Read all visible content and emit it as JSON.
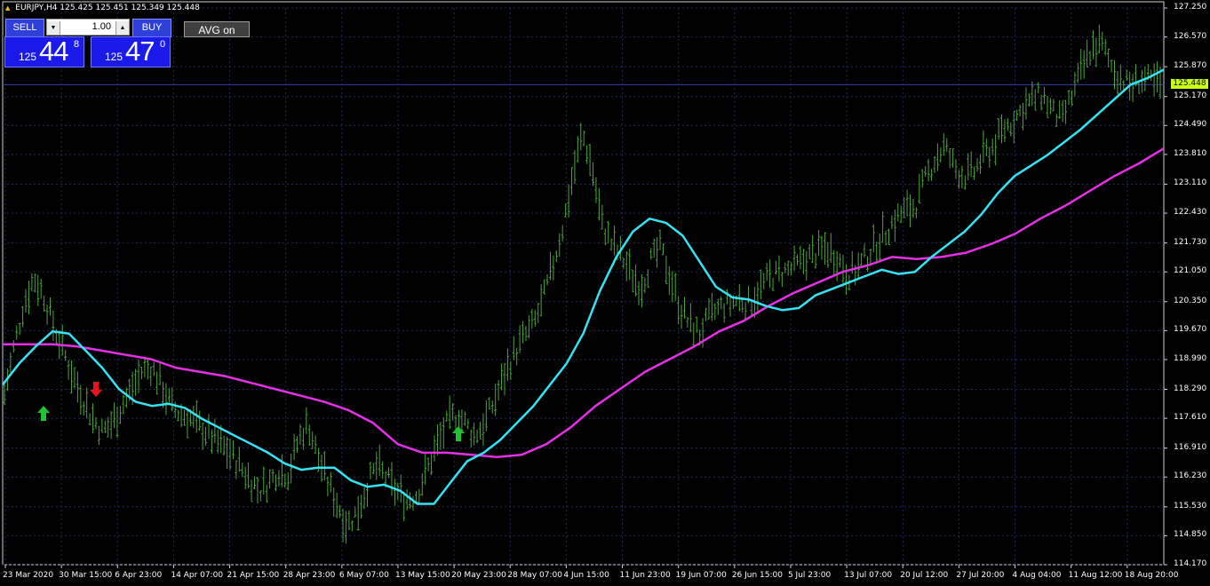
{
  "chart_header": {
    "symbol_tf": "EURJPY,H4",
    "ohlc": "125.425 125.451 125.349 125.448"
  },
  "trade_panel": {
    "sell_label": "SELL",
    "buy_label": "BUY",
    "lot_value": "1.00",
    "bid": {
      "prefix": "125",
      "big": "44",
      "sup": "8"
    },
    "ask": {
      "prefix": "125",
      "big": "47",
      "sup": "0"
    }
  },
  "avg_button": "AVG  on",
  "current_price_label": "125.448",
  "colors": {
    "background": "#000000",
    "grid": "#1f2a5e",
    "candles": "#4ca43a",
    "fast_ma": "#34e4f4",
    "slow_ma": "#e62fe6",
    "arrow_up": "#22c232",
    "arrow_down": "#e8141a",
    "price_label": "#c8ff14"
  },
  "chart_data": {
    "type": "line",
    "ylim": [
      114.17,
      127.25
    ],
    "y_ticks": [
      "127.250",
      "126.570",
      "125.870",
      "125.170",
      "124.490",
      "123.810",
      "123.110",
      "122.430",
      "121.730",
      "121.050",
      "120.350",
      "119.670",
      "118.990",
      "118.290",
      "117.610",
      "116.910",
      "116.230",
      "115.530",
      "114.850",
      "114.170"
    ],
    "x_ticks": [
      "23 Mar 2020",
      "30 Mar 15:00",
      "6 Apr 23:00",
      "14 Apr 07:00",
      "21 Apr 15:00",
      "28 Apr 23:00",
      "6 May 07:00",
      "13 May 15:00",
      "20 May 23:00",
      "28 May 07:00",
      "4 Jun 15:00",
      "11 Jun 23:00",
      "19 Jun 07:00",
      "26 Jun 15:00",
      "5 Jul 23:00",
      "13 Jul 07:00",
      "20 Jul 12:00",
      "27 Jul 20:00",
      "4 Aug 04:00",
      "11 Aug 12:00",
      "18 Aug 20:00"
    ],
    "series": [
      {
        "role": "price",
        "values": [
          118.2,
          119.3,
          120.3,
          120.9,
          120.5,
          119.8,
          119.2,
          118.6,
          118.1,
          117.6,
          117.3,
          117.5,
          117.9,
          118.3,
          118.7,
          118.8,
          118.4,
          117.9,
          117.7,
          117.6,
          117.4,
          117.2,
          117.0,
          116.8,
          116.5,
          116.2,
          115.9,
          116.1,
          116.4,
          116.3,
          117.1,
          117.5,
          116.7,
          116.1,
          115.6,
          115.1,
          115.4,
          116.0,
          116.5,
          116.2,
          115.9,
          115.7,
          115.8,
          116.3,
          116.9,
          117.4,
          117.7,
          117.5,
          117.2,
          117.5,
          118.0,
          118.6,
          119.1,
          119.5,
          119.8,
          120.4,
          121.2,
          122.1,
          123.3,
          124.3,
          123.5,
          122.2,
          121.7,
          121.4,
          121.0,
          120.7,
          121.3,
          121.6,
          120.9,
          120.2,
          119.8,
          119.6,
          120.0,
          120.2,
          120.3,
          120.4,
          120.3,
          120.6,
          120.9,
          121.0,
          121.1,
          121.2,
          121.4,
          121.5,
          121.6,
          121.4,
          121.0,
          121.1,
          121.4,
          121.7,
          122.0,
          122.3,
          122.5,
          122.6,
          123.2,
          123.7,
          124.0,
          123.5,
          123.3,
          123.4,
          123.8,
          124.0,
          124.4,
          124.6,
          124.9,
          125.1,
          125.2,
          124.8,
          124.6,
          125.2,
          125.8,
          126.3,
          126.4,
          125.9,
          125.6,
          125.4,
          125.6,
          125.5,
          125.45
        ]
      },
      {
        "role": "fast_ma",
        "values": [
          118.4,
          118.9,
          119.3,
          119.65,
          119.6,
          119.2,
          118.8,
          118.3,
          118.0,
          117.9,
          117.95,
          117.85,
          117.6,
          117.4,
          117.2,
          117.0,
          116.8,
          116.55,
          116.4,
          116.45,
          116.45,
          116.15,
          116.0,
          116.05,
          115.9,
          115.6,
          115.6,
          116.1,
          116.6,
          116.8,
          117.1,
          117.5,
          117.9,
          118.4,
          118.9,
          119.6,
          120.6,
          121.4,
          122.0,
          122.3,
          122.2,
          121.9,
          121.3,
          120.7,
          120.45,
          120.4,
          120.25,
          120.15,
          120.2,
          120.5,
          120.65,
          120.8,
          120.95,
          121.1,
          121.0,
          121.05,
          121.4,
          121.7,
          122.0,
          122.4,
          122.9,
          123.3,
          123.55,
          123.8,
          124.1,
          124.4,
          124.75,
          125.1,
          125.45,
          125.6,
          125.8
        ]
      },
      {
        "role": "slow_ma",
        "values": [
          119.35,
          119.35,
          119.35,
          119.3,
          119.2,
          119.1,
          119.0,
          118.8,
          118.7,
          118.6,
          118.45,
          118.3,
          118.15,
          118.0,
          117.8,
          117.5,
          117.0,
          116.8,
          116.8,
          116.75,
          116.7,
          116.75,
          117.0,
          117.4,
          117.9,
          118.3,
          118.7,
          119.0,
          119.3,
          119.65,
          119.9,
          120.25,
          120.55,
          120.8,
          121.05,
          121.2,
          121.4,
          121.35,
          121.4,
          121.5,
          121.7,
          121.95,
          122.3,
          122.6,
          122.95,
          123.3,
          123.6,
          123.95
        ]
      }
    ],
    "signals": [
      {
        "type": "up",
        "index": 1
      },
      {
        "type": "down",
        "index": 3
      },
      {
        "type": "up",
        "index": 8
      }
    ]
  }
}
